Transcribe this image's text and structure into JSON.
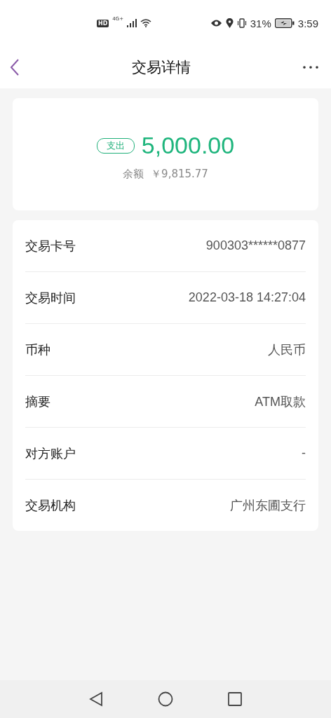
{
  "status_bar": {
    "hd": "HD",
    "network": "4G+",
    "battery": "31%",
    "time": "3:59"
  },
  "header": {
    "title": "交易详情"
  },
  "summary": {
    "tag": "支出",
    "amount": "5,000.00",
    "balance_label": "余额",
    "balance": "￥9,815.77"
  },
  "details": [
    {
      "label": "交易卡号",
      "value": "900303******0877"
    },
    {
      "label": "交易时间",
      "value": "2022-03-18 14:27:04"
    },
    {
      "label": "币种",
      "value": "人民币"
    },
    {
      "label": "摘要",
      "value": "ATM取款"
    },
    {
      "label": "对方账户",
      "value": "-"
    },
    {
      "label": "交易机构",
      "value": "广州东圃支行"
    }
  ]
}
